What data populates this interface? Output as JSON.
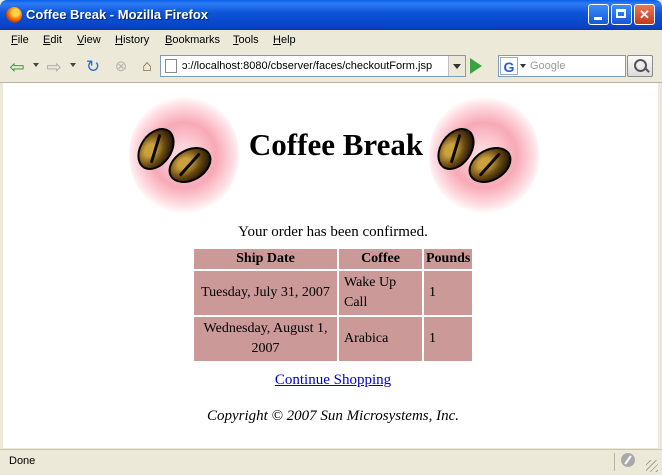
{
  "window": {
    "title": "Coffee Break - Mozilla Firefox"
  },
  "menu": [
    {
      "label": "File",
      "mnemonic": "F",
      "rest": "ile"
    },
    {
      "label": "Edit",
      "mnemonic": "E",
      "rest": "dit"
    },
    {
      "label": "View",
      "mnemonic": "V",
      "rest": "iew"
    },
    {
      "label": "History",
      "mnemonic": "H",
      "rest": "istory"
    },
    {
      "label": "Bookmarks",
      "mnemonic": "B",
      "rest": "ookmarks"
    },
    {
      "label": "Tools",
      "mnemonic": "T",
      "rest": "ools"
    },
    {
      "label": "Help",
      "mnemonic": "H",
      "rest": "elp"
    }
  ],
  "toolbar": {
    "icons": [
      "back-icon",
      "forward-icon",
      "reload-icon",
      "stop-icon",
      "home-icon",
      "go-icon",
      "search-icon"
    ],
    "url": "ɔ://localhost:8080/cbserver/faces/checkoutForm.jsp",
    "search_placeholder": "Google",
    "search_engine_glyph": "G"
  },
  "page": {
    "banner_title": "Coffee Break",
    "confirmation": "Your order has been confirmed.",
    "table": {
      "headers": [
        "Ship Date",
        "Coffee",
        "Pounds"
      ],
      "rows": [
        [
          "Tuesday, July 31, 2007",
          "Wake Up Call",
          "1"
        ],
        [
          "Wednesday, August 1, 2007",
          "Arabica",
          "1"
        ]
      ]
    },
    "continue_link": "Continue Shopping",
    "copyright": "Copyright © 2007 Sun Microsystems, Inc."
  },
  "status": {
    "text": "Done"
  },
  "colors": {
    "title_bar": "#0a53d8",
    "table_cell": "#cc9999",
    "link": "#0000cc",
    "chrome": "#ece9d8"
  }
}
